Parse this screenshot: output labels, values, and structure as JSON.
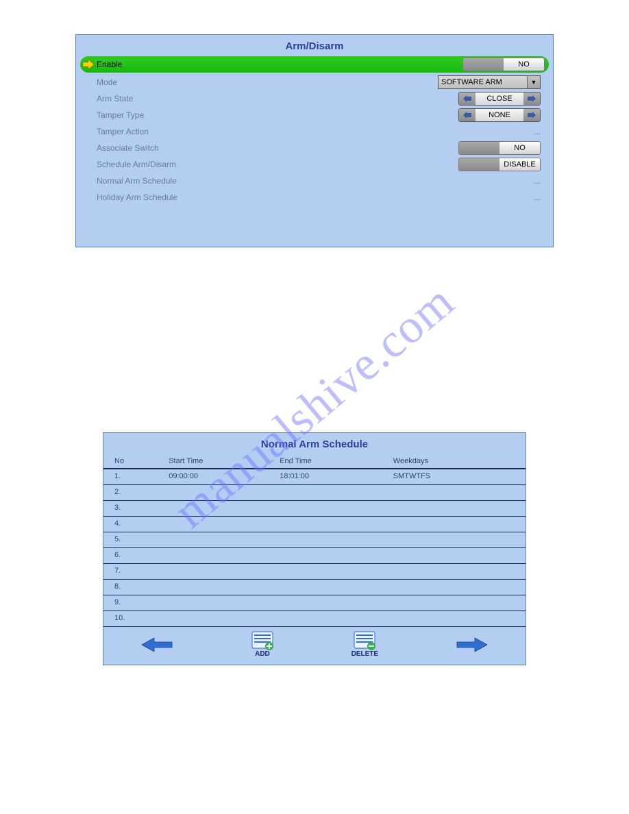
{
  "watermark": "manualshive.com",
  "arm_disarm": {
    "title": "Arm/Disarm",
    "rows": {
      "enable": {
        "label": "Enable",
        "value": "NO"
      },
      "mode": {
        "label": "Mode",
        "value": "SOFTWARE ARM"
      },
      "arm_state": {
        "label": "Arm State",
        "value": "CLOSE"
      },
      "tamper_type": {
        "label": "Tamper Type",
        "value": "NONE"
      },
      "tamper_action": {
        "label": "Tamper Action",
        "value": "..."
      },
      "associate_switch": {
        "label": "Associate Switch",
        "value": "NO"
      },
      "schedule_armdisarm": {
        "label": "Schedule Arm/Disarm",
        "value": "DISABLE"
      },
      "normal_arm_schedule": {
        "label": "Normal Arm Schedule",
        "value": "..."
      },
      "holiday_arm_schedule": {
        "label": "Holiday Arm Schedule",
        "value": "..."
      }
    }
  },
  "schedule": {
    "title": "Normal Arm Schedule",
    "columns": {
      "no": "No",
      "start": "Start Time",
      "end": "End Time",
      "weekdays": "Weekdays"
    },
    "rows": [
      {
        "no": "1.",
        "start": "09:00:00",
        "end": "18:01:00",
        "weekdays": "SMTWTFS"
      },
      {
        "no": "2.",
        "start": "",
        "end": "",
        "weekdays": ""
      },
      {
        "no": "3.",
        "start": "",
        "end": "",
        "weekdays": ""
      },
      {
        "no": "4.",
        "start": "",
        "end": "",
        "weekdays": ""
      },
      {
        "no": "5.",
        "start": "",
        "end": "",
        "weekdays": ""
      },
      {
        "no": "6.",
        "start": "",
        "end": "",
        "weekdays": ""
      },
      {
        "no": "7.",
        "start": "",
        "end": "",
        "weekdays": ""
      },
      {
        "no": "8.",
        "start": "",
        "end": "",
        "weekdays": ""
      },
      {
        "no": "9.",
        "start": "",
        "end": "",
        "weekdays": ""
      },
      {
        "no": "10.",
        "start": "",
        "end": "",
        "weekdays": ""
      }
    ],
    "toolbar": {
      "back": "",
      "add": "ADD",
      "delete": "DELETE",
      "next": ""
    }
  }
}
